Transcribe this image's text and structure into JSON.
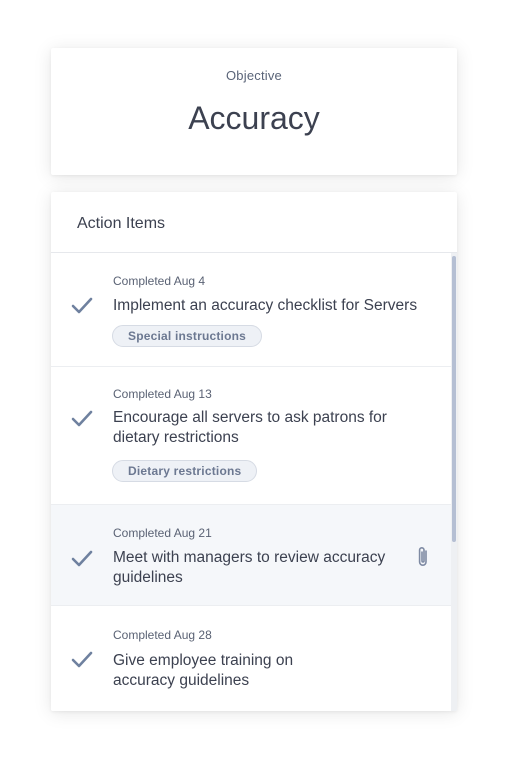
{
  "objective": {
    "label": "Objective",
    "title": "Accuracy"
  },
  "action_items": {
    "header": "Action Items",
    "items": [
      {
        "status": "Completed Aug 4",
        "text": "Implement an accuracy checklist for Servers",
        "tag": "Special instructions",
        "icon": "check-icon"
      },
      {
        "status": "Completed Aug 13",
        "text": "Encourage all servers to ask patrons for dietary restrictions",
        "tag": "Dietary restrictions",
        "icon": "check-icon"
      },
      {
        "status": "Completed Aug 21",
        "text": "Meet with managers to review accuracy guidelines",
        "attachment_icon": "paperclip-icon",
        "icon": "check-icon"
      },
      {
        "status": "Completed Aug 28",
        "text": "Give employee training on accuracy guidelines",
        "icon": "check-icon"
      }
    ]
  },
  "colors": {
    "check": "#6f819f",
    "text": "#3c4150",
    "muted": "#5a6274",
    "tag_bg": "#eef1f6",
    "tag_text": "#6c7891",
    "highlight_row": "#f5f7fa",
    "scroll_thumb": "#b5bfd3"
  }
}
